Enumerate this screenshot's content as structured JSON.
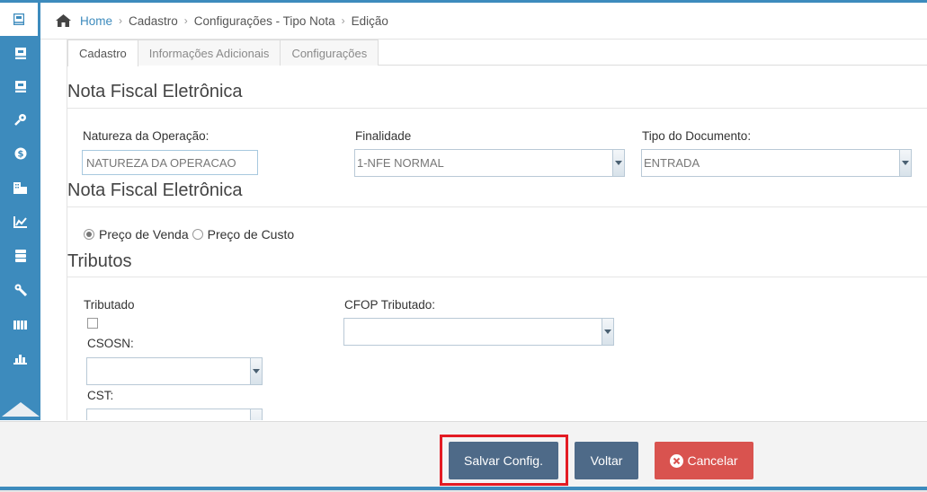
{
  "breadcrumb": {
    "home": "Home",
    "items": [
      "Cadastro",
      "Configurações - Tipo Nota",
      "Edição"
    ]
  },
  "tabs": [
    {
      "label": "Cadastro",
      "active": true
    },
    {
      "label": "Informações Adicionais",
      "active": false
    },
    {
      "label": "Configurações",
      "active": false
    }
  ],
  "section1": {
    "title": "Nota Fiscal Eletrônica",
    "natureza": {
      "label": "Natureza da Operação:",
      "placeholder": "NATUREZA DA OPERACAO"
    },
    "finalidade": {
      "label": "Finalidade",
      "value": "1-NFE NORMAL"
    },
    "tipo_documento": {
      "label": "Tipo do Documento:",
      "value": "ENTRADA"
    }
  },
  "section2": {
    "title": "Nota Fiscal Eletrônica",
    "radio_venda": "Preço de Venda",
    "radio_custo": "Preço de Custo",
    "selected": "venda"
  },
  "section3": {
    "title": "Tributos",
    "tributado_label": "Tributado",
    "csosn_label": "CSOSN:",
    "cst_label": "CST:",
    "cfop_label": "CFOP Tributado:"
  },
  "footer": {
    "save_label": "Salvar Config.",
    "back_label": "Voltar",
    "cancel_label": "Cancelar"
  },
  "colors": {
    "accent": "#3d8bbd",
    "button_primary": "#4e6a88",
    "button_danger": "#d9534f",
    "highlight": "#e31b23"
  },
  "sidebar_icons": [
    "book-icon",
    "book-icon",
    "book-icon",
    "key-icon",
    "coin-icon",
    "building-icon",
    "chart-line-icon",
    "server-icon",
    "wrench-icon",
    "library-icon",
    "bar-chart-icon"
  ]
}
